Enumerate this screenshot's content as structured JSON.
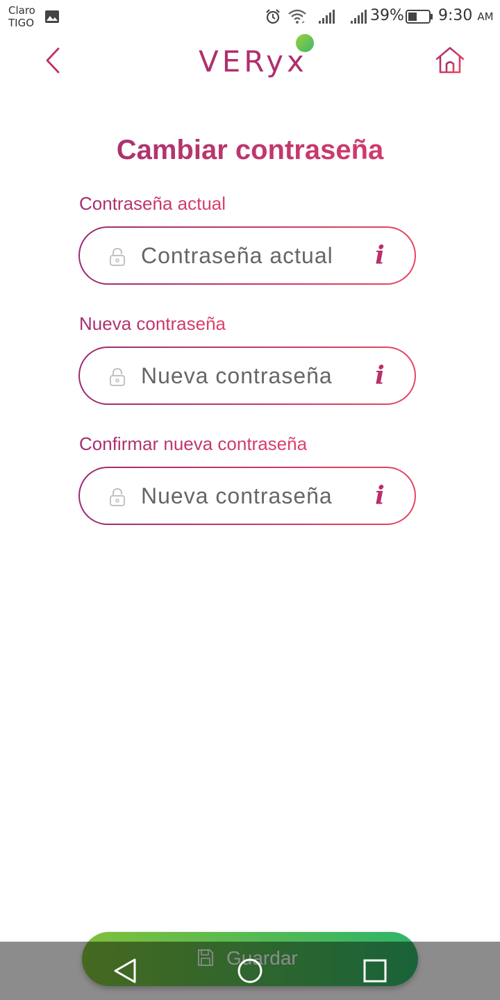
{
  "status_bar": {
    "carrier_line1": "Claro",
    "carrier_line2": "TIGO",
    "battery": "39%",
    "time": "9:30",
    "ampm": "AM",
    "icons": [
      "gallery-icon",
      "alarm-icon",
      "wifi-icon",
      "signal-icon",
      "signal-icon",
      "battery-icon"
    ]
  },
  "header": {
    "logo": "VERyx",
    "back_icon": "chevron-left-icon",
    "home_icon": "home-icon",
    "brand_colors": {
      "magenta": "#b0306c",
      "pink": "#e0406a",
      "green": "#3bb96a",
      "lime": "#9ccf3a"
    }
  },
  "page": {
    "title": "Cambiar contraseña"
  },
  "form": {
    "fields": [
      {
        "label": "Contraseña actual",
        "placeholder": "Contraseña actual",
        "value": ""
      },
      {
        "label": "Nueva contraseña",
        "placeholder": "Nueva contraseña",
        "value": ""
      },
      {
        "label": "Confirmar nueva contraseña",
        "placeholder": "Nueva contraseña",
        "value": ""
      }
    ],
    "info_glyph": "i",
    "save_label": "Guardar"
  },
  "navbar": {
    "icons": [
      "nav-back-icon",
      "nav-home-icon",
      "nav-recent-icon"
    ]
  }
}
